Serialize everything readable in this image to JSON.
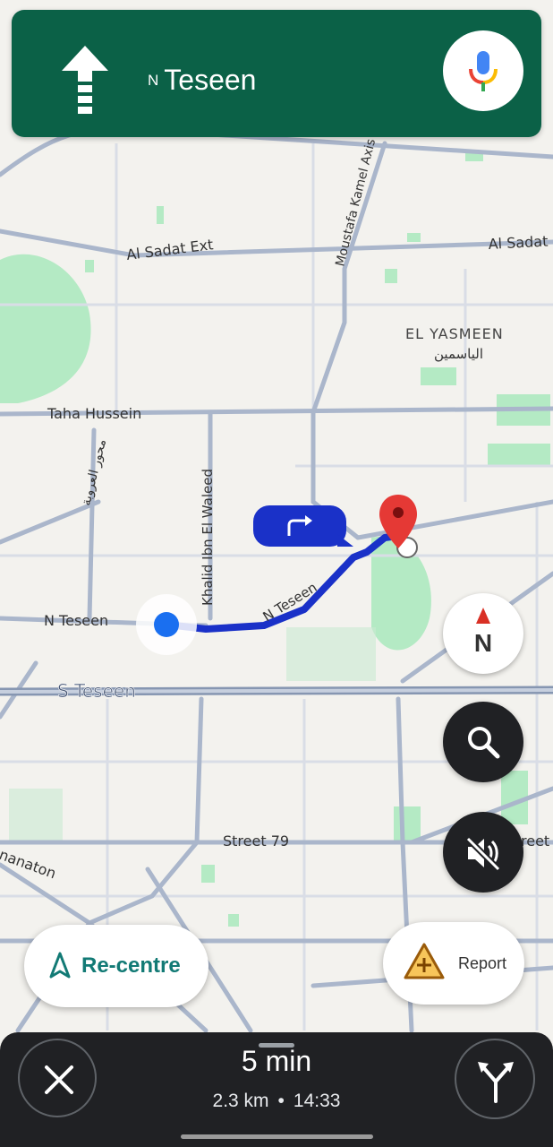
{
  "navigation": {
    "direction_icon": "straight-arrow-icon",
    "street_prefix": "N",
    "street_name": "Teseen"
  },
  "map": {
    "labels": {
      "al_sadat_ext": "Al Sadat Ext",
      "al_sadat_right": "Al Sadat",
      "moustafa_kamel": "Moustafa Kamel Axis",
      "el_yasmeen": "EL YASMEEN",
      "el_yasmeen_ar": "الياسمين",
      "taha_hussein": "Taha Hussein",
      "mehwar_arabic": "محور العروبة",
      "khalid_ibn_el_waleed": "Khalid Ibn El Waleed",
      "n_teseen": "N Teseen",
      "n_teseen_route": "N Teseen",
      "s_teseen": "S Teseen",
      "street_79": "Street 79",
      "lanaton": "nanaton",
      "street_right": "reet"
    },
    "route_color": "#1a31c8",
    "park_color": "#a8e6b9"
  },
  "controls": {
    "compass_label": "N",
    "recentre_label": "Re-centre",
    "report_label": "Report"
  },
  "trip": {
    "duration": "5 min",
    "distance": "2.3 km",
    "separator": "•",
    "arrival": "14:33"
  }
}
